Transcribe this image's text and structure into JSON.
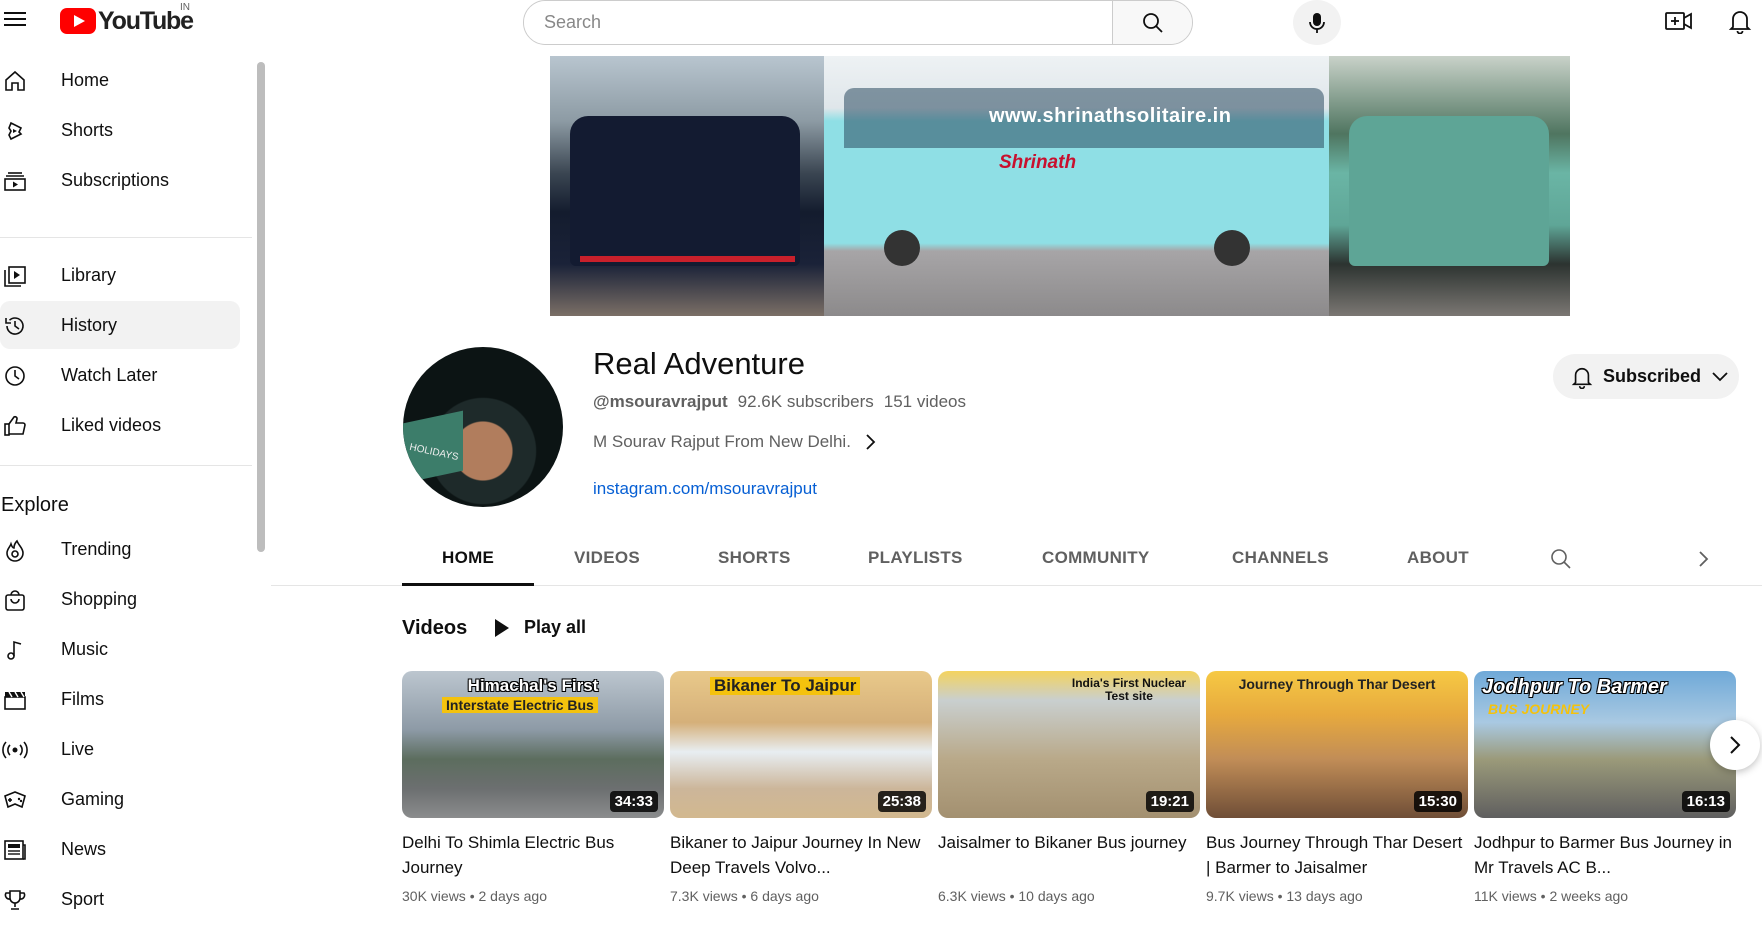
{
  "topbar": {
    "logo_text": "YouTube",
    "country": "IN",
    "search_placeholder": "Search"
  },
  "sidebar": {
    "main": [
      {
        "label": "Home",
        "icon": "home-icon"
      },
      {
        "label": "Shorts",
        "icon": "shorts-icon"
      },
      {
        "label": "Subscriptions",
        "icon": "subscriptions-icon"
      }
    ],
    "library": [
      {
        "label": "Library",
        "icon": "library-icon"
      },
      {
        "label": "History",
        "icon": "history-icon",
        "active": true
      },
      {
        "label": "Watch Later",
        "icon": "clock-icon"
      },
      {
        "label": "Liked videos",
        "icon": "thumbs-up-icon"
      }
    ],
    "explore_title": "Explore",
    "explore": [
      {
        "label": "Trending",
        "icon": "trending-icon"
      },
      {
        "label": "Shopping",
        "icon": "shopping-bag-icon"
      },
      {
        "label": "Music",
        "icon": "music-note-icon"
      },
      {
        "label": "Films",
        "icon": "clapperboard-icon"
      },
      {
        "label": "Live",
        "icon": "live-icon"
      },
      {
        "label": "Gaming",
        "icon": "gamepad-icon"
      },
      {
        "label": "News",
        "icon": "newspaper-icon"
      },
      {
        "label": "Sport",
        "icon": "trophy-icon"
      }
    ]
  },
  "banner": {
    "website_text": "www.shrinathsolitaire.in",
    "brand_text": "Shrinath"
  },
  "channel": {
    "name": "Real Adventure",
    "handle": "@msouravrajput",
    "subscribers": "92.6K subscribers",
    "video_count": "151 videos",
    "description": "M Sourav Rajput From New Delhi.",
    "link": "instagram.com/msouravrajput",
    "subscribe_label": "Subscribed",
    "avatar_tag": "HOLIDAYS"
  },
  "tabs": [
    "HOME",
    "VIDEOS",
    "SHORTS",
    "PLAYLISTS",
    "COMMUNITY",
    "CHANNELS",
    "ABOUT"
  ],
  "active_tab": "HOME",
  "shelf": {
    "title": "Videos",
    "play_all": "Play all",
    "videos": [
      {
        "thumb_title": "Himachal's First",
        "thumb_sub": "Interstate Electric Bus",
        "duration": "34:33",
        "title": "Delhi To Shimla Electric Bus Journey",
        "views": "30K views",
        "age": "2 days ago"
      },
      {
        "thumb_title": "Bikaner To Jaipur",
        "thumb_sub": "",
        "duration": "25:38",
        "title": "Bikaner to Jaipur Journey In New Deep Travels Volvo...",
        "views": "7.3K views",
        "age": "6 days ago"
      },
      {
        "thumb_title": "India's First Nuclear Test site",
        "thumb_sub": "",
        "duration": "19:21",
        "title": "Jaisalmer to Bikaner Bus journey",
        "views": "6.3K views",
        "age": "10 days ago"
      },
      {
        "thumb_title": "Journey Through Thar Desert",
        "thumb_sub": "",
        "duration": "15:30",
        "title": "Bus Journey Through Thar Desert | Barmer to Jaisalmer",
        "views": "9.7K views",
        "age": "13 days ago"
      },
      {
        "thumb_title": "Jodhpur To Barmer",
        "thumb_sub": "BUS JOURNEY",
        "duration": "16:13",
        "title": "Jodhpur to Barmer Bus Journey in Mr Travels AC B...",
        "views": "11K views",
        "age": "2 weeks ago"
      }
    ]
  },
  "colors": {
    "brand_red": "#ff0000",
    "link_blue": "#065fd4",
    "text_secondary": "#606060"
  }
}
